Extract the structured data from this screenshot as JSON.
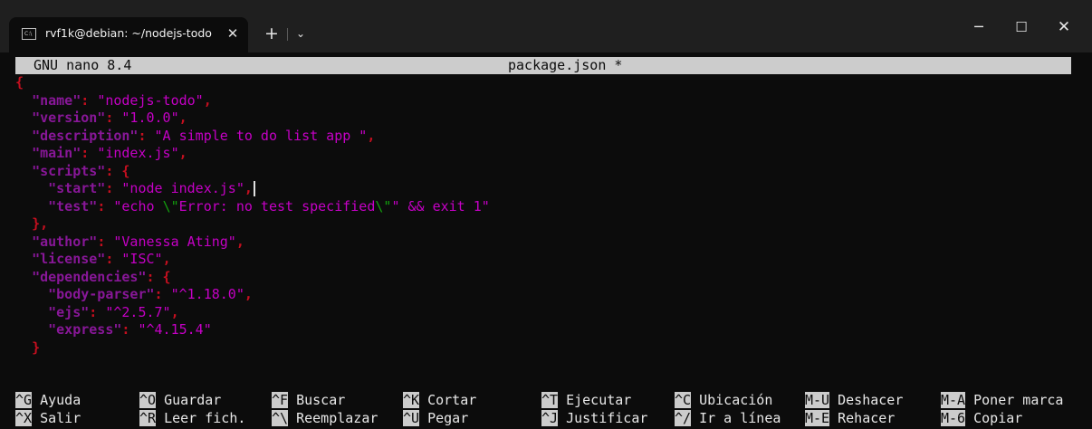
{
  "window": {
    "tab_title": "rvf1k@debian: ~/nodejs-todo",
    "tab_icon": "terminal-icon",
    "tab_close": "✕",
    "new_tab": "+",
    "dropdown": "⌄",
    "minimize": "─",
    "maximize": "☐",
    "close": "✕"
  },
  "nano": {
    "version": "GNU nano 8.4",
    "filename": "package.json *"
  },
  "editor": {
    "lines": [
      [
        [
          "brace",
          "{"
        ]
      ],
      [
        [
          "sp",
          "  "
        ],
        [
          "key",
          "\"name\""
        ],
        [
          "punc",
          ": "
        ],
        [
          "str",
          "\"nodejs-todo\""
        ],
        [
          "punc",
          ","
        ]
      ],
      [
        [
          "sp",
          "  "
        ],
        [
          "key",
          "\"version\""
        ],
        [
          "punc",
          ": "
        ],
        [
          "str",
          "\"1.0.0\""
        ],
        [
          "punc",
          ","
        ]
      ],
      [
        [
          "sp",
          "  "
        ],
        [
          "key",
          "\"description\""
        ],
        [
          "punc",
          ": "
        ],
        [
          "str",
          "\"A simple to do list app \""
        ],
        [
          "punc",
          ","
        ]
      ],
      [
        [
          "sp",
          "  "
        ],
        [
          "key",
          "\"main\""
        ],
        [
          "punc",
          ": "
        ],
        [
          "str",
          "\"index.js\""
        ],
        [
          "punc",
          ","
        ]
      ],
      [
        [
          "sp",
          "  "
        ],
        [
          "key",
          "\"scripts\""
        ],
        [
          "punc",
          ": {"
        ]
      ],
      [
        [
          "sp",
          "    "
        ],
        [
          "key",
          "\"start\""
        ],
        [
          "punc",
          ": "
        ],
        [
          "str",
          "\"node index.js\""
        ],
        [
          "punc",
          ","
        ],
        [
          "cursor",
          ""
        ]
      ],
      [
        [
          "sp",
          "    "
        ],
        [
          "key",
          "\"test\""
        ],
        [
          "punc",
          ": "
        ],
        [
          "str",
          "\"echo "
        ],
        [
          "esc",
          "\\\""
        ],
        [
          "str",
          "Error: no test specified"
        ],
        [
          "esc",
          "\\\""
        ],
        [
          "str",
          "\" && exit 1\""
        ]
      ],
      [
        [
          "sp",
          "  "
        ],
        [
          "brace",
          "},"
        ]
      ],
      [
        [
          "sp",
          "  "
        ],
        [
          "key",
          "\"author\""
        ],
        [
          "punc",
          ": "
        ],
        [
          "str",
          "\"Vanessa Ating\""
        ],
        [
          "punc",
          ","
        ]
      ],
      [
        [
          "sp",
          "  "
        ],
        [
          "key",
          "\"license\""
        ],
        [
          "punc",
          ": "
        ],
        [
          "str",
          "\"ISC\""
        ],
        [
          "punc",
          ","
        ]
      ],
      [
        [
          "sp",
          "  "
        ],
        [
          "key",
          "\"dependencies\""
        ],
        [
          "punc",
          ": {"
        ]
      ],
      [
        [
          "sp",
          "    "
        ],
        [
          "key",
          "\"body-parser\""
        ],
        [
          "punc",
          ": "
        ],
        [
          "str",
          "\"^1.18.0\""
        ],
        [
          "punc",
          ","
        ]
      ],
      [
        [
          "sp",
          "    "
        ],
        [
          "key",
          "\"ejs\""
        ],
        [
          "punc",
          ": "
        ],
        [
          "str",
          "\"^2.5.7\""
        ],
        [
          "punc",
          ","
        ]
      ],
      [
        [
          "sp",
          "    "
        ],
        [
          "key",
          "\"express\""
        ],
        [
          "punc",
          ": "
        ],
        [
          "str",
          "\"^4.15.4\""
        ]
      ],
      [
        [
          "sp",
          "  "
        ],
        [
          "brace",
          "}"
        ]
      ]
    ]
  },
  "shortcuts": [
    {
      "key": "^G",
      "label": "Ayuda"
    },
    {
      "key": "^X",
      "label": "Salir"
    },
    {
      "key": "^O",
      "label": "Guardar"
    },
    {
      "key": "^R",
      "label": "Leer fich."
    },
    {
      "key": "^F",
      "label": "Buscar"
    },
    {
      "key": "^\\",
      "label": "Reemplazar"
    },
    {
      "key": "^K",
      "label": "Cortar"
    },
    {
      "key": "^U",
      "label": "Pegar"
    },
    {
      "key": "^T",
      "label": "Ejecutar"
    },
    {
      "key": "^J",
      "label": "Justificar"
    },
    {
      "key": "^C",
      "label": "Ubicación"
    },
    {
      "key": "^/",
      "label": "Ir a línea"
    },
    {
      "key": "M-U",
      "label": "Deshacer"
    },
    {
      "key": "M-E",
      "label": "Rehacer"
    },
    {
      "key": "M-A",
      "label": "Poner marca"
    },
    {
      "key": "M-6",
      "label": "Copiar"
    }
  ]
}
